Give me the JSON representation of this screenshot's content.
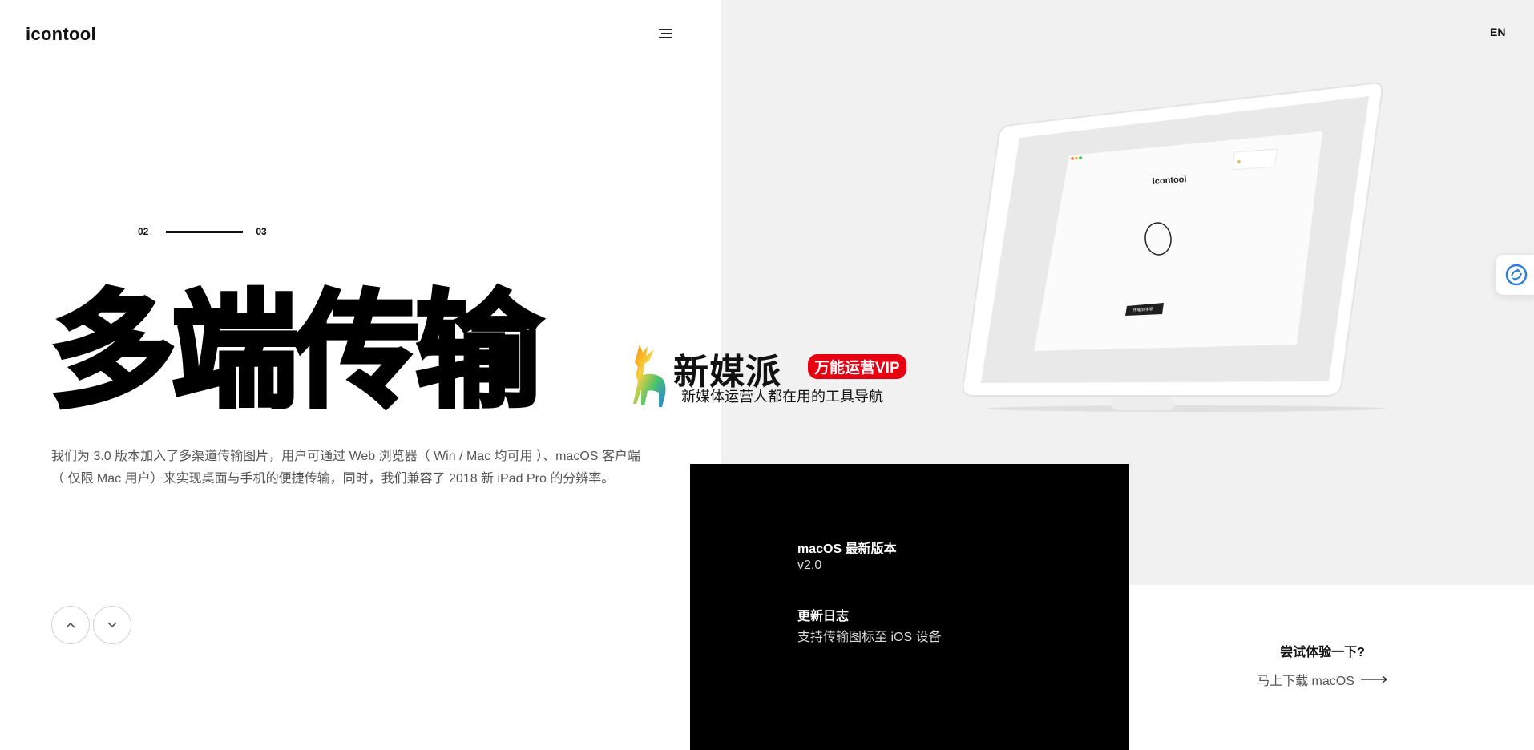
{
  "header": {
    "logo": "icontool",
    "lang": "EN"
  },
  "pager": {
    "current": "02",
    "next": "03"
  },
  "hero": {
    "headline": "多端传输",
    "description": "我们为 3.0 版本加入了多渠道传输图片，用户可通过 Web 浏览器（ Win / Mac 均可用 ）、macOS 客户端（ 仅限 Mac 用户）来实现桌面与手机的便捷传输，同时，我们兼容了 2018 新 iPad Pro 的分辨率。"
  },
  "mockup": {
    "logo": "icontool",
    "button": "传输到手机"
  },
  "watermark": {
    "title": "新媒派",
    "badge": "万能运营VIP",
    "subtitle": "新媒体运营人都在用的工具导航"
  },
  "release": {
    "version_heading": "macOS 最新版本",
    "version_value": "v2.0",
    "changelog_heading": "更新日志",
    "changelog_value": "支持传输图标至 iOS 设备"
  },
  "try": {
    "heading": "尝试体验一下?",
    "link": "马上下载 macOS"
  },
  "icons": [
    "menu-icon",
    "chevron-up-icon",
    "chevron-down-icon",
    "arrow-right-icon",
    "deer-logo-icon",
    "translate-icon"
  ],
  "colors": {
    "accent_red": "#e60012",
    "panel_black": "#000000",
    "right_bg": "#f1f1f1"
  }
}
